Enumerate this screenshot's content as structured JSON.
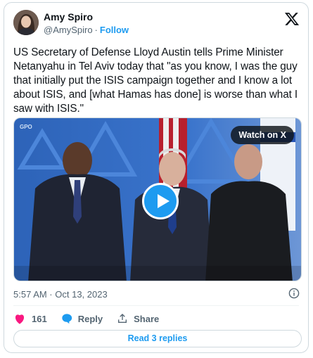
{
  "author": {
    "name": "Amy Spiro",
    "handle": "@AmySpiro",
    "separator": "·",
    "follow_label": "Follow"
  },
  "tweet": {
    "text": "US Secretary of Defense Lloyd Austin tells Prime Minister Netanyahu in Tel Aviv today that \"as you know, I was the guy that initially put the ISIS campaign together and I know a lot about ISIS, and [what Hamas has done] is worse than what I saw with ISIS.\""
  },
  "media": {
    "watch_label": "Watch on X",
    "watermark": "GPO"
  },
  "timestamp": "5:57 AM · Oct 13, 2023",
  "actions": {
    "likes": "161",
    "reply_label": "Reply",
    "share_label": "Share"
  },
  "replies_button": "Read 3 replies",
  "colors": {
    "accent": "#1d9bf0",
    "like": "#f91880",
    "text": "#0f1419",
    "secondary": "#536471"
  }
}
